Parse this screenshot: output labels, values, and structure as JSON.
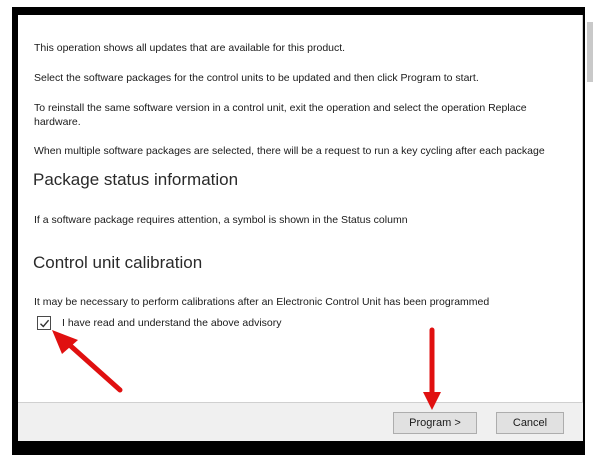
{
  "content": {
    "para1": "This operation shows all updates that are available for this product.",
    "para2": "Select the software packages for the control units to be updated and then click Program to start.",
    "para3": "To reinstall the same software version in a control unit, exit the operation and select the operation Replace hardware.",
    "para4": "When multiple software packages are selected, there will be a request to run a key cycling after each package",
    "heading1": "Package status information",
    "para5": "If a software package requires attention, a symbol is shown in the Status column",
    "heading2": "Control unit calibration",
    "para6": "It may be necessary to perform calibrations after an Electronic Control Unit has been programmed"
  },
  "advisory": {
    "checked": true,
    "label": "I have read and understand the above advisory"
  },
  "buttons": {
    "program_label": "Program >",
    "cancel_label": "Cancel"
  },
  "annotations": {
    "arrow_color": "#e01010",
    "icon": "check-icon"
  }
}
